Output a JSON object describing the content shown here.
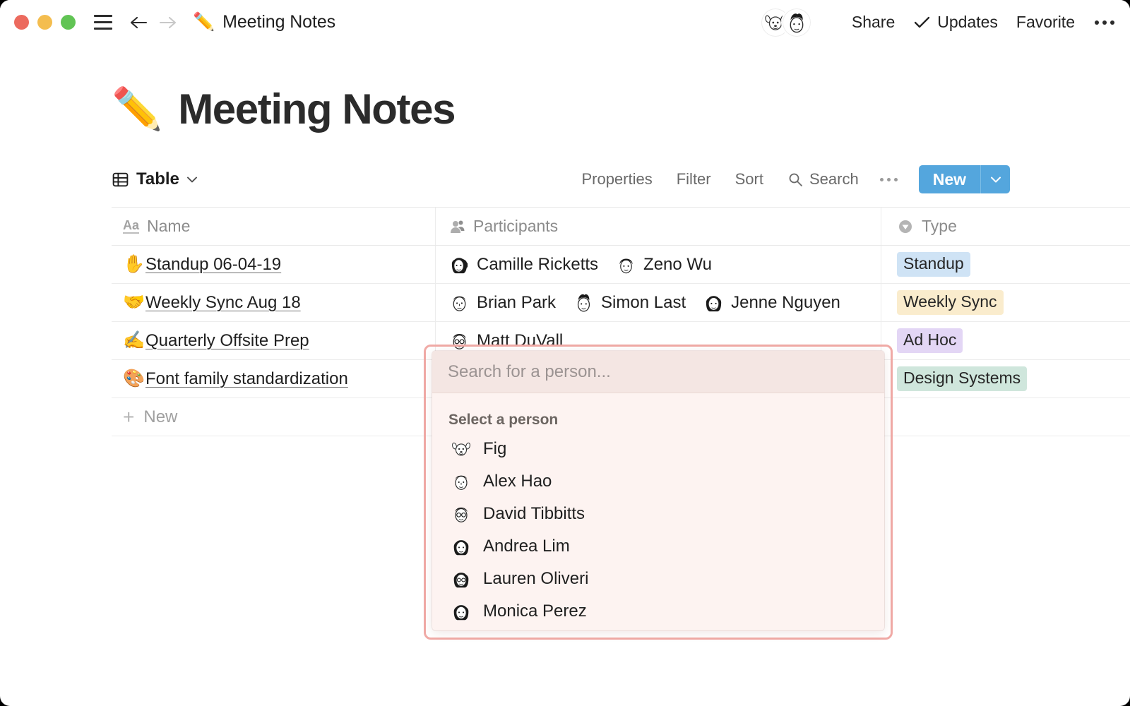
{
  "window": {
    "traffic_lights": [
      {
        "name": "close",
        "color": "#ec6a5e"
      },
      {
        "name": "minimize",
        "color": "#f4bd4f"
      },
      {
        "name": "maximize",
        "color": "#61c454"
      }
    ]
  },
  "titlebar": {
    "menu_icon": "hamburger-icon",
    "back_icon": "arrow-left-icon",
    "forward_icon": "arrow-right-icon",
    "breadcrumb_emoji": "✏️",
    "breadcrumb_title": "Meeting Notes",
    "avatars": [
      {
        "name": "fig-avatar",
        "alt": "Fig"
      },
      {
        "name": "user-avatar",
        "alt": "User"
      }
    ],
    "share_label": "Share",
    "updates_label": "Updates",
    "updates_icon": "check-icon",
    "favorite_label": "Favorite",
    "more_icon": "ellipsis-icon"
  },
  "page": {
    "emoji": "✏️",
    "title": "Meeting Notes"
  },
  "view_toolbar": {
    "view_icon": "table-icon",
    "view_label": "Table",
    "view_chevron": "chevron-down-icon",
    "properties_label": "Properties",
    "filter_label": "Filter",
    "sort_label": "Sort",
    "search_label": "Search",
    "search_icon": "search-icon",
    "more_icon": "ellipsis-icon",
    "new_label": "New",
    "new_caret_icon": "chevron-down-icon",
    "new_button_color": "#54a6dd"
  },
  "table": {
    "columns": [
      {
        "key": "name",
        "label": "Name",
        "icon": "text-type-icon"
      },
      {
        "key": "participants",
        "label": "Participants",
        "icon": "person-icon"
      },
      {
        "key": "type",
        "label": "Type",
        "icon": "select-type-icon"
      }
    ],
    "rows": [
      {
        "emoji": "✋",
        "name": "Standup 06-04-19",
        "participants": [
          {
            "name": "Camille Ricketts",
            "avatar": "camille-avatar"
          },
          {
            "name": "Zeno Wu",
            "avatar": "zeno-avatar"
          }
        ],
        "type": {
          "label": "Standup",
          "color": "#cfe3f5"
        }
      },
      {
        "emoji": "🤝",
        "name": "Weekly Sync Aug 18",
        "participants": [
          {
            "name": "Brian Park",
            "avatar": "brian-avatar"
          },
          {
            "name": "Simon Last",
            "avatar": "simon-avatar"
          },
          {
            "name": "Jenne Nguyen",
            "avatar": "jenne-avatar"
          }
        ],
        "type": {
          "label": "Weekly Sync",
          "color": "#faeccd"
        }
      },
      {
        "emoji": "✍️",
        "name": "Quarterly Offsite Prep",
        "participants": [
          {
            "name": "Matt DuVall",
            "avatar": "matt-avatar"
          }
        ],
        "type": {
          "label": "Ad Hoc",
          "color": "#e3d6f5"
        }
      },
      {
        "emoji": "🎨",
        "name": "Font family standardization",
        "participants": [],
        "type": {
          "label": "Design Systems",
          "color": "#cfe6dc"
        }
      }
    ],
    "new_row_label": "New",
    "new_row_icon": "plus-icon"
  },
  "person_picker": {
    "search_placeholder": "Search for a person...",
    "search_value": "",
    "section_label": "Select a person",
    "highlight_color": "#f0aaa6",
    "background_color": "#fdf3f1",
    "people": [
      {
        "name": "Fig",
        "avatar": "fig-avatar"
      },
      {
        "name": "Alex Hao",
        "avatar": "alex-avatar"
      },
      {
        "name": "David Tibbitts",
        "avatar": "david-avatar"
      },
      {
        "name": "Andrea Lim",
        "avatar": "andrea-avatar"
      },
      {
        "name": "Lauren Oliveri",
        "avatar": "lauren-avatar"
      },
      {
        "name": "Monica Perez",
        "avatar": "monica-avatar"
      }
    ]
  }
}
